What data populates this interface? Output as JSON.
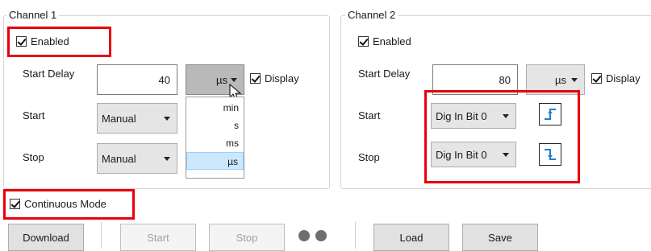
{
  "channel1": {
    "title": "Channel 1",
    "enabled_label": "Enabled",
    "start_delay_label": "Start Delay",
    "start_delay_value": "40",
    "unit_value": "µs",
    "display_label": "Display",
    "start_label": "Start",
    "start_value": "Manual",
    "stop_label": "Stop",
    "stop_value": "Manual",
    "unit_options": [
      "min",
      "s",
      "ms",
      "µs"
    ]
  },
  "channel2": {
    "title": "Channel 2",
    "enabled_label": "Enabled",
    "start_delay_label": "Start Delay",
    "start_delay_value": "80",
    "unit_value": "µs",
    "display_label": "Display",
    "start_label": "Start",
    "start_value": "Dig In Bit 0",
    "stop_label": "Stop",
    "stop_value": "Dig In Bit 0"
  },
  "continuous_mode_label": "Continuous Mode",
  "buttons": {
    "download": "Download",
    "start": "Start",
    "stop": "Stop",
    "load": "Load",
    "save": "Save"
  },
  "colors": {
    "highlight": "#e8000b",
    "edge_icon": "#1a7fd0"
  }
}
